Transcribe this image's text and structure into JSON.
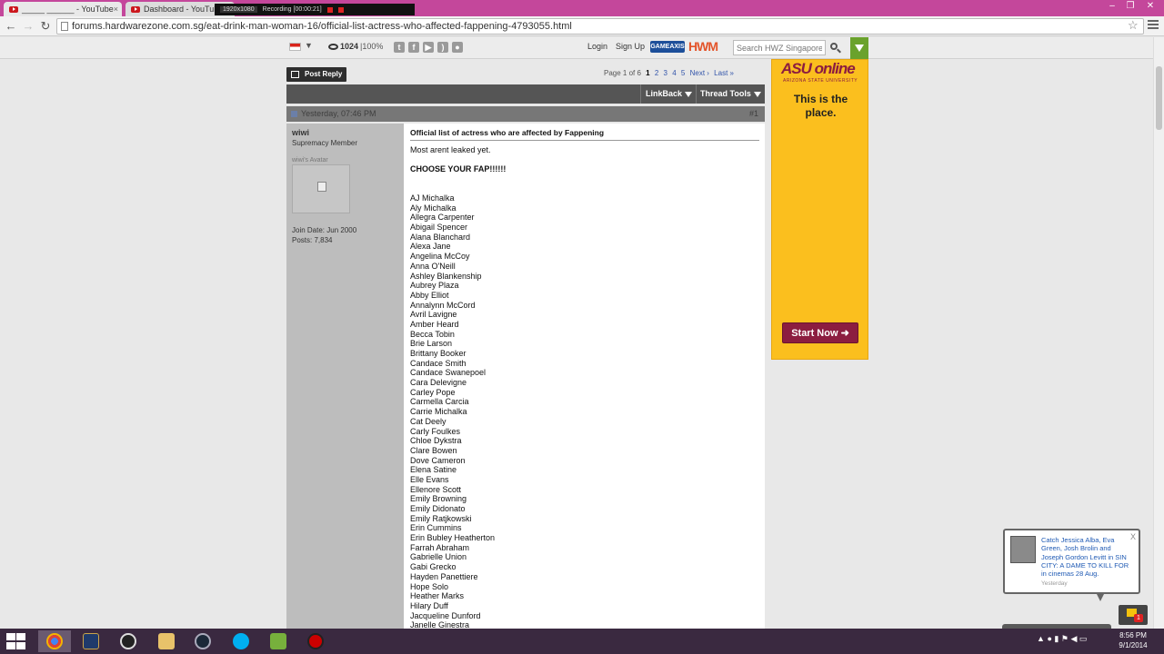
{
  "browser": {
    "tabs": [
      {
        "label": "_____ ______ - YouTube",
        "icon": "youtube-icon"
      },
      {
        "label": "Dashboard - YouTube",
        "icon": "youtube-icon"
      }
    ],
    "recorder": {
      "resolution": "1920x1080",
      "status": "Recording [00:00:21]"
    },
    "url": "forums.hardwarezone.com.sg/eat-drink-man-woman-16/official-list-actress-who-affected-fappening-4793055.html"
  },
  "hwz_header": {
    "online_count": "1024",
    "online_pct": "|100%",
    "login": "Login",
    "signup": "Sign Up",
    "gameaxis": "GAMEAXIS",
    "hwm": "HWM",
    "search_placeholder": "Search HWZ Singapore"
  },
  "thread": {
    "post_reply": "Post Reply",
    "page_label": "Page 1 of 6",
    "pages": [
      "1",
      "2",
      "3",
      "4",
      "5"
    ],
    "next": "Next ›",
    "last": "Last »",
    "linkback": "LinkBack",
    "thread_tools": "Thread Tools"
  },
  "post": {
    "date": "Yesterday, 07:46 PM",
    "number": "#1",
    "username": "wiwi",
    "user_title": "Supremacy Member",
    "avatar_caption": "wiwi's Avatar",
    "join_date": "Join Date: Jun 2000",
    "posts": "Posts: 7,834",
    "title": "Official list of actress who are affected by Fappening",
    "line1": "Most arent leaked yet.",
    "line2": "CHOOSE YOUR FAP!!!!!!",
    "actresses": [
      "AJ Michalka",
      "Aly Michalka",
      "Allegra Carpenter",
      "Abigail Spencer",
      "Alana Blanchard",
      "Alexa Jane",
      "Angelina McCoy",
      "Anna O'Neill",
      "Ashley Blankenship",
      "Aubrey Plaza",
      "Abby Elliot",
      "Annalynn McCord",
      "Avril Lavigne",
      "Amber Heard",
      "Becca Tobin",
      "Brie Larson",
      "Brittany Booker",
      "Candace Smith",
      "Candace Swanepoel",
      "Cara Delevigne",
      "Carley Pope",
      "Carmella Carcia",
      "Carrie Michalka",
      "Cat Deely",
      "Carly Foulkes",
      "Chloe Dykstra",
      "Clare Bowen",
      "Dove Cameron",
      "Elena Satine",
      "Elle Evans",
      "Ellenore Scott",
      "Emily Browning",
      "Emily Didonato",
      "Emily Ratjkowski",
      "Erin Cummins",
      "Erin Bubley Heatherton",
      "Farrah Abraham",
      "Gabrielle Union",
      "Gabi Grecko",
      "Hayden Panettiere",
      "Hope Solo",
      "Heather Marks",
      "Hilary Duff",
      "Jacqueline Dunford",
      "Janelle Ginestra"
    ]
  },
  "ad": {
    "logo": "ASU online",
    "logo_sub": "ARIZONA STATE UNIVERSITY",
    "headline_1": "This is the",
    "headline_2": "place.",
    "cta": "Start Now"
  },
  "popup": {
    "text": "Catch Jessica Alba, Eva Green, Josh Brolin and Joseph Gordon Levitt in SIN CITY: A DAME TO KILL FOR in cinemas 28 Aug.",
    "time": "Yesterday",
    "close": "X",
    "badge": "1"
  },
  "taskbar": {
    "time": "8:56 PM",
    "date": "9/1/2014"
  },
  "colors": {
    "title_bar": "#c4479b",
    "taskbar": "#3a2940",
    "ad_yellow": "#fbbf1e",
    "ad_maroon": "#8c1d40",
    "hwz_green": "#6aa22c"
  }
}
